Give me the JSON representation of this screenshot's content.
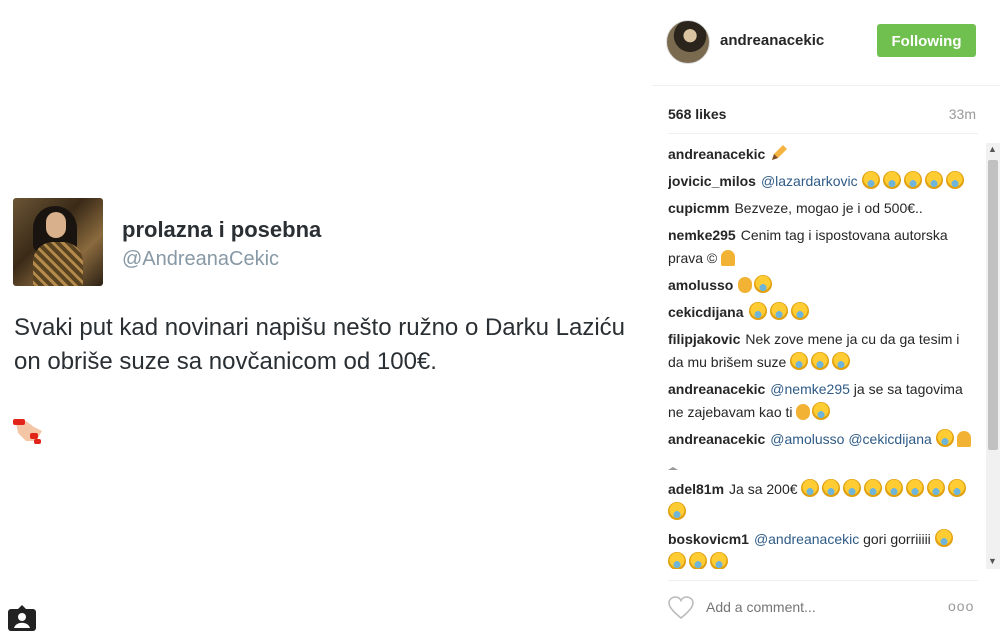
{
  "tweet": {
    "name": "prolazna i posebna",
    "handle": "@AndreanaCekic",
    "text": "Svaki put kad novinari napišu nešto ružno o Darku Laziću on obriše suze sa novčanicom od 100€."
  },
  "post": {
    "username": "andreanacekic",
    "follow_label": "Following",
    "likes": "568 likes",
    "time": "33m",
    "add_comment_placeholder": "Add a comment...",
    "more_label": "ooo"
  },
  "comments": [
    {
      "user": "andreanacekic",
      "text": "",
      "emoji": [
        "pen"
      ]
    },
    {
      "user": "jovicic_milos",
      "text": "",
      "mention": "@lazardarkovic",
      "emoji": [
        "grin",
        "grin",
        "grin",
        "grin",
        "grin"
      ]
    },
    {
      "user": "cupicmm",
      "text": "Bezveze, mogao je i od 500€.."
    },
    {
      "user": "nemke295",
      "text": "Cenim tag i ispostovana autorska prava ©",
      "emoji": [
        "flex"
      ]
    },
    {
      "user": "amolusso",
      "text": "",
      "emoji": [
        "ok",
        "grin"
      ]
    },
    {
      "user": "cekicdijana",
      "text": "",
      "emoji": [
        "grin",
        "grin",
        "grin"
      ]
    },
    {
      "user": "filipjakovic",
      "text": "Nek zove mene ja cu da ga tesim i da mu brišem suze",
      "emoji": [
        "grin",
        "grin",
        "grin"
      ]
    },
    {
      "user": "andreanacekic",
      "mention": "@nemke295",
      "text": "ja se sa tagovima ne zajebavam kao ti",
      "emoji": [
        "ok",
        "grin"
      ]
    },
    {
      "user": "andreanacekic",
      "mention": "@amolusso @cekicdijana",
      "text": "",
      "emoji": [
        "grin",
        "flex",
        "wine"
      ]
    },
    {
      "user": "adel81m",
      "text": "Ja sa 200€",
      "emoji": [
        "grin",
        "grin",
        "grin",
        "grin",
        "grin",
        "grin",
        "grin",
        "grin",
        "grin"
      ]
    },
    {
      "user": "boskovicm1",
      "mention": "@andreanacekic",
      "text": "gori gorriiiii",
      "emoji": [
        "grin",
        "grin",
        "grin",
        "grin"
      ]
    }
  ],
  "colors": {
    "follow_green": "#70c050",
    "mention_blue": "#2f5b87"
  }
}
